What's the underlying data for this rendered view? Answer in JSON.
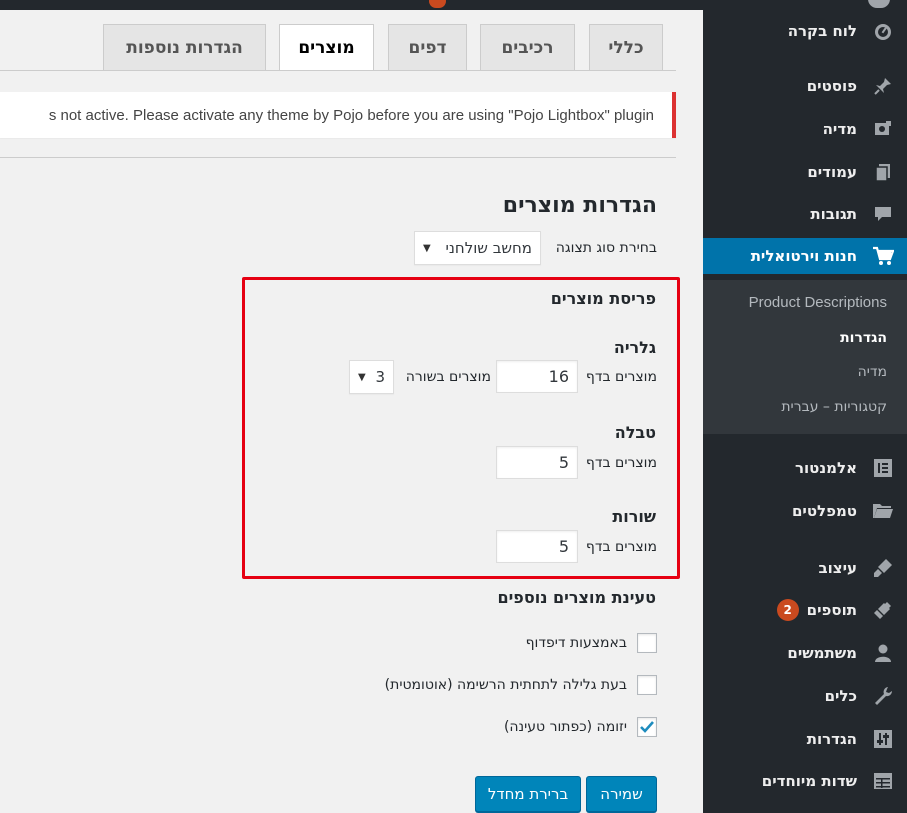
{
  "sidebar": {
    "dashboard": "לוח בקרה",
    "posts": "פוסטים",
    "media": "מדיה",
    "pages": "עמודים",
    "comments": "תגובות",
    "store": "חנות וירטואלית",
    "submenu": {
      "product_descriptions": "Product Descriptions",
      "settings": "הגדרות",
      "media": "מדיה",
      "categories": "קטגוריות – עברית"
    },
    "elementor": "אלמנטור",
    "templates": "טמפלטים",
    "appearance": "עיצוב",
    "plugins": "תוספים",
    "plugins_badge": "2",
    "users": "משתמשים",
    "tools": "כלים",
    "settings": "הגדרות",
    "custom_fields": "שדות מיוחדים"
  },
  "tabs": {
    "general": "כללי",
    "components": "רכיבים",
    "pages": "דפים",
    "products": "מוצרים",
    "advanced": "הגדרות נוספות"
  },
  "notice": {
    "text": "s not active. Please activate any theme by Pojo before you are using \"Pojo Lightbox\" plugin"
  },
  "main": {
    "title": "הגדרות מוצרים",
    "display_type_label": "בחירת סוג תצוגה",
    "display_type_value": "מחשב שולחני",
    "layout_title": "פריסת מוצרים",
    "gallery": {
      "title": "גלריה",
      "per_page_label": "מוצרים בדף",
      "per_page_value": "16",
      "per_row_label": "מוצרים בשורה",
      "per_row_value": "3"
    },
    "table": {
      "title": "טבלה",
      "per_page_label": "מוצרים בדף",
      "per_page_value": "5"
    },
    "rows": {
      "title": "שורות",
      "per_page_label": "מוצרים בדף",
      "per_page_value": "5"
    },
    "load_more_title": "טעינת מוצרים נוספים",
    "options": [
      {
        "label": "באמצעות דיפדוף",
        "checked": false
      },
      {
        "label": "בעת גלילה לתחתית הרשימה (אוטומטית)",
        "checked": false
      },
      {
        "label": "יזומה (כפתור טעינה)",
        "checked": true
      }
    ],
    "save_label": "שמירה",
    "reset_label": "ברירת מחדל"
  },
  "colors": {
    "accent": "#0073aa",
    "button": "#0085ba",
    "highlight": "#e60012",
    "notice_error": "#dc3232",
    "sidebar_bg": "#23282d"
  }
}
